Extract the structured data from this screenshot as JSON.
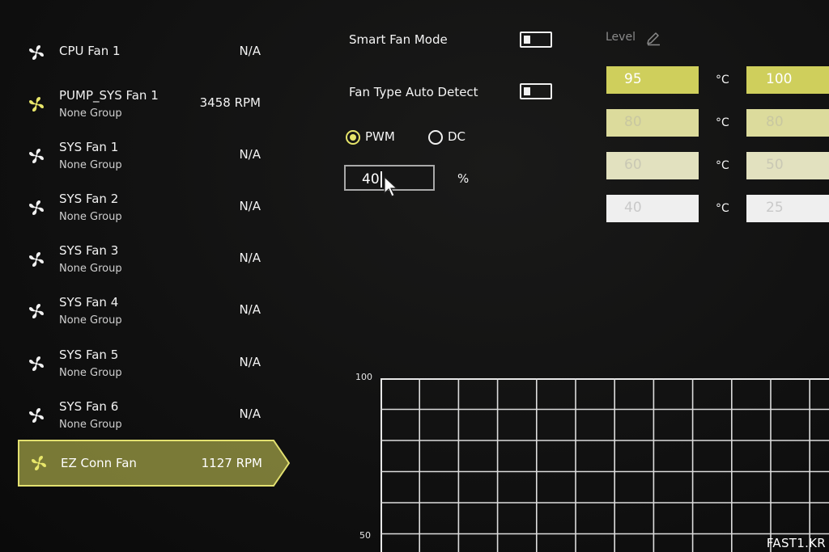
{
  "fans": [
    {
      "name": "CPU Fan 1",
      "group": "",
      "speed": "N/A",
      "active": false
    },
    {
      "name": "PUMP_SYS Fan 1",
      "group": "None Group",
      "speed": "3458 RPM",
      "active": true
    },
    {
      "name": "SYS Fan 1",
      "group": "None Group",
      "speed": "N/A",
      "active": false
    },
    {
      "name": "SYS Fan 2",
      "group": "None Group",
      "speed": "N/A",
      "active": false
    },
    {
      "name": "SYS Fan 3",
      "group": "None Group",
      "speed": "N/A",
      "active": false
    },
    {
      "name": "SYS Fan 4",
      "group": "None Group",
      "speed": "N/A",
      "active": false
    },
    {
      "name": "SYS Fan 5",
      "group": "None Group",
      "speed": "N/A",
      "active": false
    },
    {
      "name": "SYS Fan 6",
      "group": "None Group",
      "speed": "N/A",
      "active": false
    },
    {
      "name": "EZ Conn Fan",
      "group": "",
      "speed": "1127 RPM",
      "active": true,
      "selected": true
    }
  ],
  "controls": {
    "smart_fan_mode_label": "Smart Fan Mode",
    "smart_fan_mode_on": false,
    "fan_type_auto_detect_label": "Fan Type Auto Detect",
    "fan_type_auto_detect_on": false,
    "mode_options": [
      "PWM",
      "DC"
    ],
    "mode_selected": "PWM",
    "speed_percent_value": "40",
    "speed_percent_unit": "%"
  },
  "level": {
    "label": "Level",
    "edit_icon": "pencil-icon",
    "temp_unit": "°C",
    "rows": [
      {
        "temp": "95",
        "speed": "100"
      },
      {
        "temp": "80",
        "speed": "80"
      },
      {
        "temp": "60",
        "speed": "50"
      },
      {
        "temp": "40",
        "speed": "25"
      }
    ]
  },
  "graph": {
    "y_ticks": [
      "100",
      "50"
    ]
  },
  "colors": {
    "accent": "#d4d45a",
    "active_fan_icon": "#e8e66a",
    "inactive_fan_icon": "#f0f0f0"
  },
  "watermark": "FAST1.KR"
}
